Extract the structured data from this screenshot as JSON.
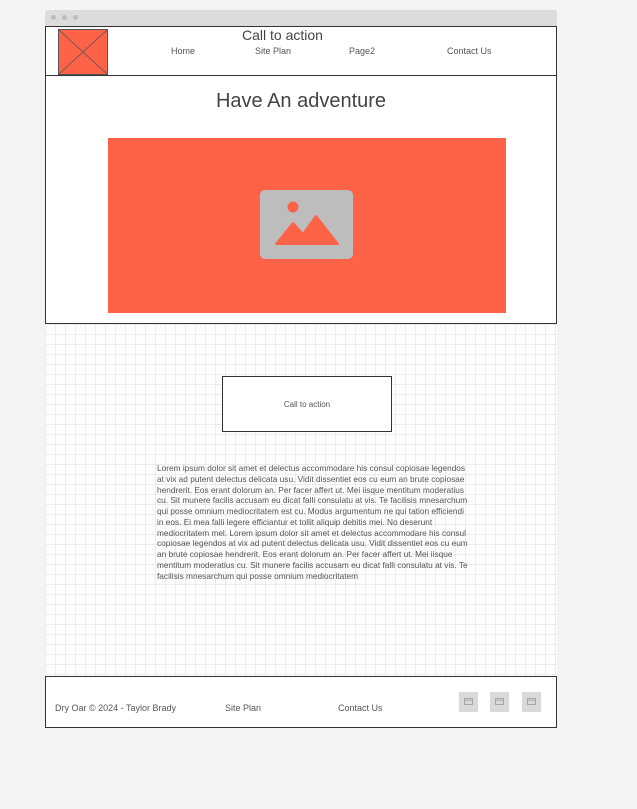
{
  "header": {
    "title": "Call to action",
    "nav": [
      "Home",
      "Site Plan",
      "Page2",
      "Contact Us"
    ]
  },
  "hero": {
    "title": "Have An adventure"
  },
  "main": {
    "cta_button": "Call to action",
    "body_text": "Lorem ipsum dolor sit amet et delectus accommodare his consul copiosae legendos at vix ad putent delectus delicata usu. Vidit dissentiet eos cu eum an brute copiosae hendrerit. Eos erant dolorum an. Per facer affert ut. Mei iisque mentitum moderatius cu. Sit munere facilis accusam eu dicat falli consulatu at vis. Te facilisis mnesarchum qui posse omnium mediocritatem est cu. Modus argumentum ne qui tation efficiendi in eos. Ei mea falli legere efficiantur et tollit aliquip debitis mei. No deserunt mediocritatem mel. Lorem ipsum dolor sit amet et delectus accommodare his consul copiosae legendos at vix ad putent delectus delicata usu. Vidit dissentiet eos cu eum an brute copiosae hendrerit. Eos erant dolorum an. Per facer affert ut. Mei iisque mentitum moderatius cu. Sit munere facilis accusam eu dicat falli consulatu at vis. Te facilisis mnesarchum qui posse omnium mediocritatem"
  },
  "footer": {
    "copyright": "Dry Oar © 2024 - Taylor Brady",
    "links": [
      "Site Plan",
      "Contact Us"
    ],
    "social_icons": [
      "social-icon",
      "social-icon",
      "social-icon"
    ]
  },
  "colors": {
    "accent": "#ff6347",
    "placeholder_icon": "#bdbdbd",
    "border": "#333333",
    "page_bg": "#f4f4f4"
  }
}
